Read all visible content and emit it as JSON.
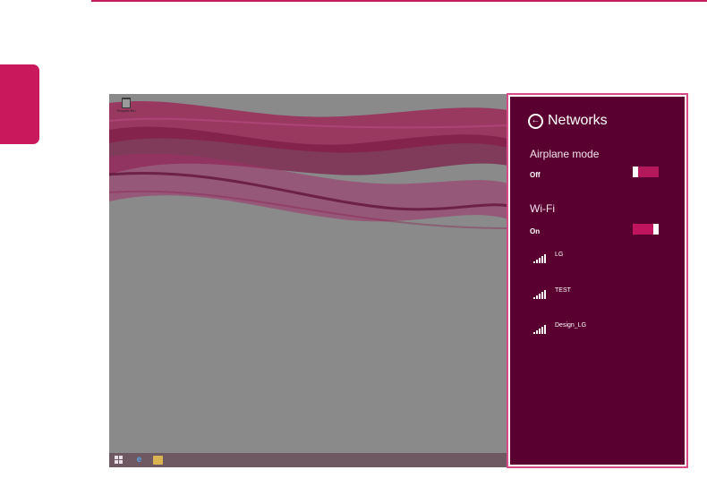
{
  "desktop": {
    "recycle_bin_label": "Recycle Bin",
    "taskbar": {
      "start_icon": "windows-start-icon",
      "browser_icon": "internet-explorer-icon",
      "explorer_icon": "file-explorer-icon"
    }
  },
  "panel": {
    "title": "Networks",
    "back_icon": "back-arrow-icon",
    "airplane": {
      "label": "Airplane mode",
      "state_label": "Off",
      "on": false
    },
    "wifi": {
      "label": "Wi-Fi",
      "state_label": "On",
      "on": true
    },
    "networks": [
      {
        "ssid": "LG",
        "signal_icon": "wifi-signal-icon",
        "signal_bars": 5
      },
      {
        "ssid": "TEST",
        "signal_icon": "wifi-signal-icon",
        "signal_bars": 5
      },
      {
        "ssid": "Design_LG",
        "signal_icon": "wifi-signal-icon",
        "signal_bars": 5
      }
    ]
  },
  "colors": {
    "accent": "#c9195c",
    "panel_bg": "#5a0030",
    "toggle": "#c0155e",
    "desktop_bg": "#8a8a8a"
  }
}
